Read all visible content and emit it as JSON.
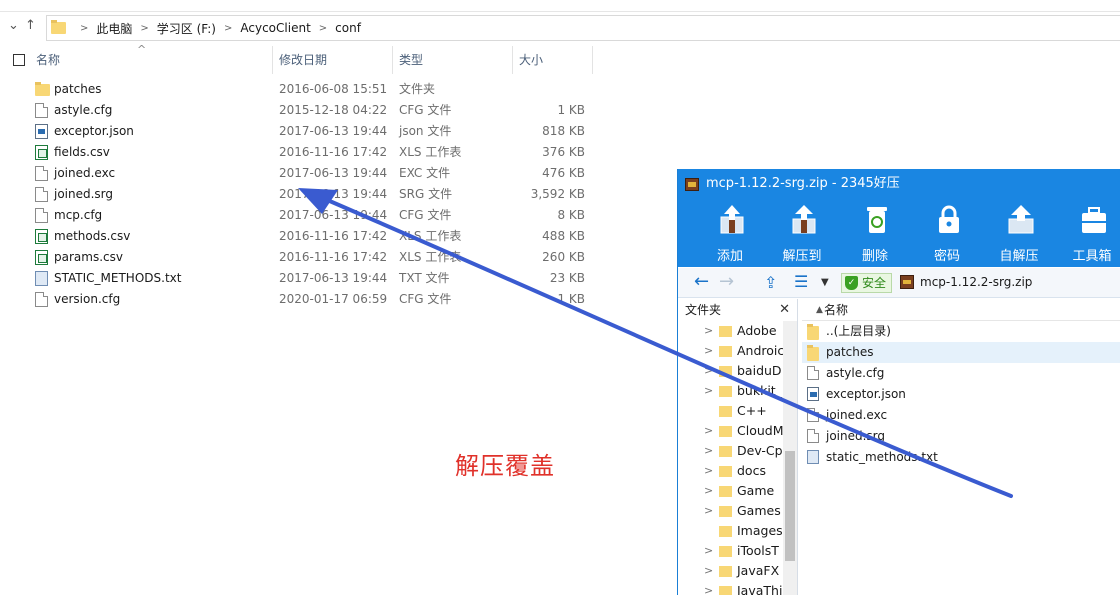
{
  "explorer": {
    "breadcrumb": [
      "此电脑",
      "学习区 (F:)",
      "AcycoClient",
      "conf"
    ],
    "columns": {
      "name": "名称",
      "date": "修改日期",
      "type": "类型",
      "size": "大小"
    },
    "files": [
      {
        "name": "patches",
        "date": "2016-06-08 15:51",
        "type": "文件夹",
        "size": "",
        "icon": "folder-icon"
      },
      {
        "name": "astyle.cfg",
        "date": "2015-12-18 04:22",
        "type": "CFG 文件",
        "size": "1 KB",
        "icon": "document-icon"
      },
      {
        "name": "exceptor.json",
        "date": "2017-06-13 19:44",
        "type": "json 文件",
        "size": "818 KB",
        "icon": "json-file-icon"
      },
      {
        "name": "fields.csv",
        "date": "2016-11-16 17:42",
        "type": "XLS 工作表",
        "size": "376 KB",
        "icon": "spreadsheet-icon"
      },
      {
        "name": "joined.exc",
        "date": "2017-06-13 19:44",
        "type": "EXC 文件",
        "size": "476 KB",
        "icon": "document-icon"
      },
      {
        "name": "joined.srg",
        "date": "2017-06-13 19:44",
        "type": "SRG 文件",
        "size": "3,592 KB",
        "icon": "document-icon"
      },
      {
        "name": "mcp.cfg",
        "date": "2017-06-13 19:44",
        "type": "CFG 文件",
        "size": "8 KB",
        "icon": "document-icon"
      },
      {
        "name": "methods.csv",
        "date": "2016-11-16 17:42",
        "type": "XLS 工作表",
        "size": "488 KB",
        "icon": "spreadsheet-icon"
      },
      {
        "name": "params.csv",
        "date": "2016-11-16 17:42",
        "type": "XLS 工作表",
        "size": "260 KB",
        "icon": "spreadsheet-icon"
      },
      {
        "name": "STATIC_METHODS.txt",
        "date": "2017-06-13 19:44",
        "type": "TXT 文件",
        "size": "23 KB",
        "icon": "text-file-icon"
      },
      {
        "name": "version.cfg",
        "date": "2020-01-17 06:59",
        "type": "CFG 文件",
        "size": "1 KB",
        "icon": "document-icon"
      }
    ]
  },
  "zip": {
    "title": "mcp-1.12.2-srg.zip - 2345好压",
    "toolbar": [
      "添加",
      "解压到",
      "删除",
      "密码",
      "自解压",
      "工具箱"
    ],
    "safe_label": "安全",
    "path": "mcp-1.12.2-srg.zip",
    "tree_title": "文件夹",
    "tree": [
      "Adobe",
      "Androic",
      "baiduD",
      "bukkit_",
      "C++",
      "CloudM",
      "Dev-Cp",
      "docs",
      "Game",
      "Games",
      "Images",
      "iToolsT",
      "JavaFX",
      "JavaThi"
    ],
    "list_header": "名称",
    "entries": [
      {
        "name": "..(上层目录)",
        "icon": "folder-icon"
      },
      {
        "name": "patches",
        "icon": "folder-icon"
      },
      {
        "name": "astyle.cfg",
        "icon": "document-icon"
      },
      {
        "name": "exceptor.json",
        "icon": "json-file-icon"
      },
      {
        "name": "joined.exc",
        "icon": "document-icon"
      },
      {
        "name": "joined.srg",
        "icon": "document-icon"
      },
      {
        "name": "static_methods.txt",
        "icon": "text-file-icon"
      }
    ]
  },
  "annotation": "解压覆盖",
  "colors": {
    "zip_blue": "#1a86e2",
    "arrow_blue": "#3a5bd0",
    "annotation_red": "#e0312a"
  }
}
